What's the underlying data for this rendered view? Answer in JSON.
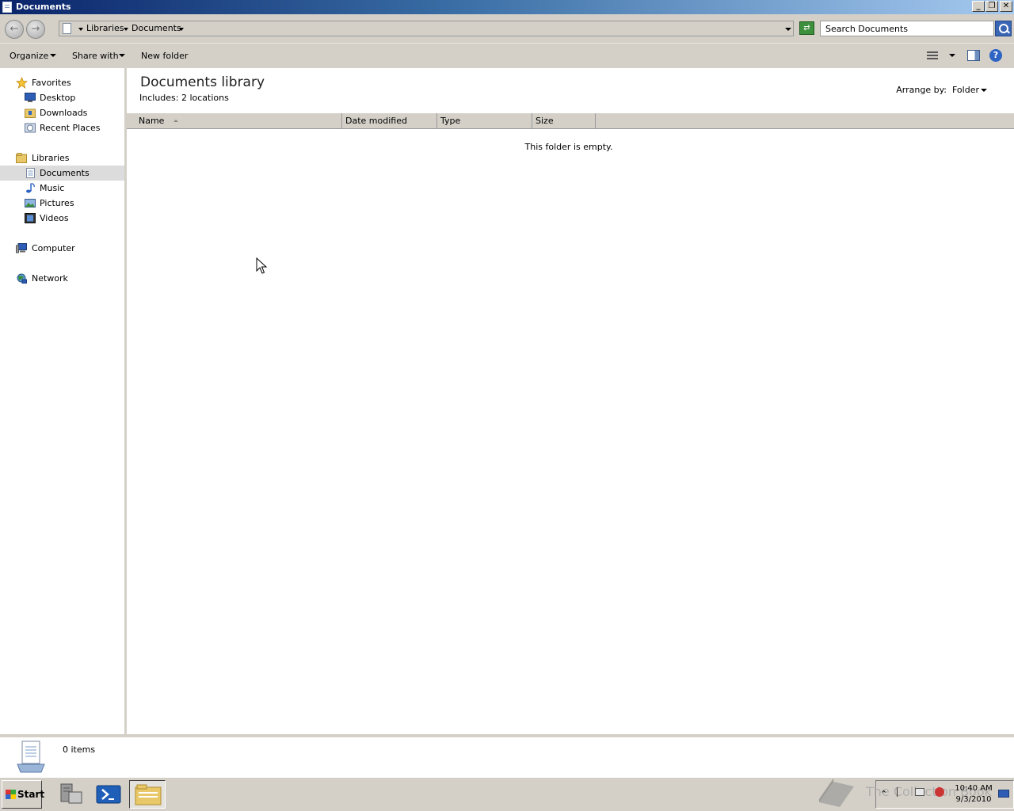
{
  "window": {
    "title": "Documents",
    "minimize": "_",
    "restore": "❐",
    "close": "✕"
  },
  "address": {
    "back_glyph": "←",
    "forward_glyph": "→",
    "crumbs": [
      "Libraries",
      "Documents"
    ],
    "refresh_glyph": "⇄",
    "search_placeholder": "Search Documents"
  },
  "toolbar": {
    "organize": "Organize",
    "share_with": "Share with",
    "new_folder": "New folder",
    "help_glyph": "?"
  },
  "nav": {
    "favorites": {
      "label": "Favorites",
      "items": [
        "Desktop",
        "Downloads",
        "Recent Places"
      ]
    },
    "libraries": {
      "label": "Libraries",
      "items": [
        "Documents",
        "Music",
        "Pictures",
        "Videos"
      ],
      "selected": "Documents"
    },
    "computer": "Computer",
    "network": "Network"
  },
  "library": {
    "title": "Documents library",
    "includes": "Includes:  2 locations",
    "arrange_label": "Arrange by:",
    "arrange_value": "Folder"
  },
  "columns": [
    "Name",
    "Date modified",
    "Type",
    "Size"
  ],
  "empty_message": "This folder is empty.",
  "details": {
    "item_count": "0 items"
  },
  "taskbar": {
    "start": "Start",
    "clock_time": "10:40 AM",
    "clock_date": "9/3/2010",
    "watermark": "The Collection Book"
  },
  "colors": {
    "title_bar": "#0a246a",
    "chrome": "#d4d0c8",
    "selection": "#dcdcdc",
    "accent": "#3a66b5"
  }
}
